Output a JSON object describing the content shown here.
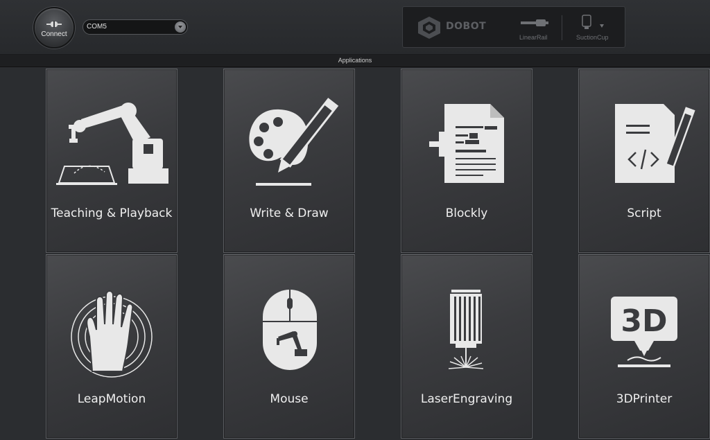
{
  "toolbar": {
    "connect_label": "Connect",
    "port_value": "COM5",
    "brand": "DOBOT",
    "linear_rail_label": "LinearRail",
    "end_effector_label": "SuctionCup"
  },
  "section": {
    "title": "Applications"
  },
  "apps": [
    {
      "label": "Teaching & Playback",
      "icon": "robot-arm-icon"
    },
    {
      "label": "Write & Draw",
      "icon": "palette-pencil-icon"
    },
    {
      "label": "Blockly",
      "icon": "blockly-document-icon"
    },
    {
      "label": "Script",
      "icon": "script-document-icon"
    },
    {
      "label": "LeapMotion",
      "icon": "hand-icon"
    },
    {
      "label": "Mouse",
      "icon": "mouse-icon"
    },
    {
      "label": "LaserEngraving",
      "icon": "laser-icon"
    },
    {
      "label": "3DPrinter",
      "icon": "3d-printer-icon"
    }
  ],
  "colors": {
    "background": "#2b2d30",
    "tile": "#3a3b3e",
    "icon": "#e8e8e8"
  }
}
